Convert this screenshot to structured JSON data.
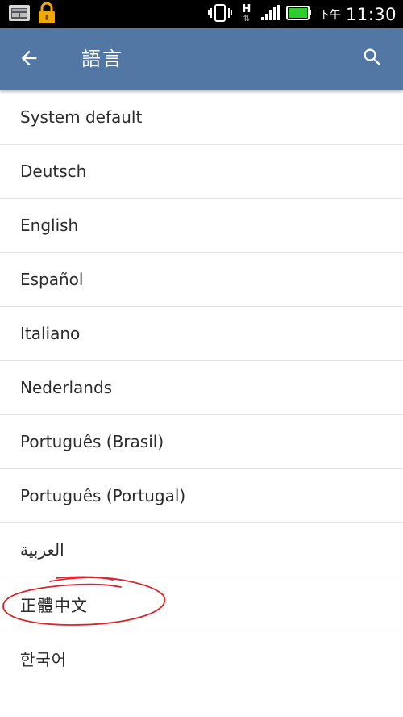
{
  "status_bar": {
    "network_type": "H",
    "am_pm": "下午",
    "time": "11:30"
  },
  "app_bar": {
    "title": "語言",
    "back_icon": "arrow-back-icon",
    "search_icon": "search-icon",
    "color": "#5277a4"
  },
  "languages": [
    {
      "label": "System default"
    },
    {
      "label": "Deutsch"
    },
    {
      "label": "English"
    },
    {
      "label": "Español"
    },
    {
      "label": "Italiano"
    },
    {
      "label": "Nederlands"
    },
    {
      "label": "Português (Brasil)"
    },
    {
      "label": "Português (Portugal)"
    },
    {
      "label": "العربية"
    },
    {
      "label": "正體中文"
    },
    {
      "label": "한국어"
    }
  ],
  "annotation": {
    "color": "#d9262b",
    "marks": "正體中文"
  }
}
